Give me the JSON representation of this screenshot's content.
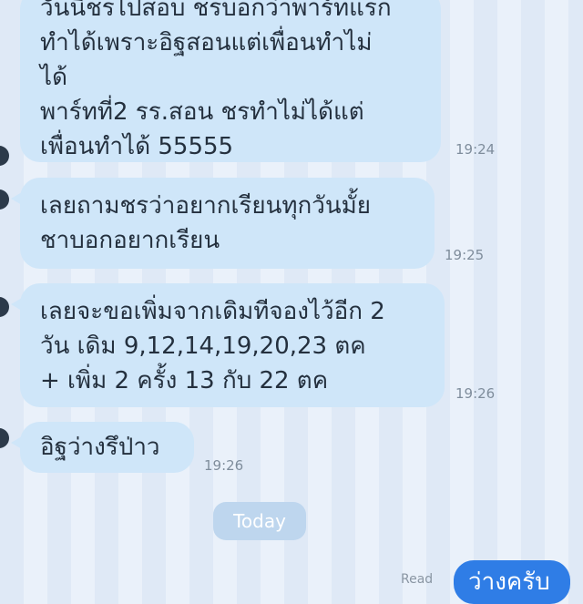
{
  "messages": [
    {
      "lines": [
        "วันนี้ชรไปสอบ ชรบอกว่าพาร์ทแรก",
        "ทำได้เพราะอิฐสอนแต่เพื่อนทำไม่",
        "ได้",
        "พาร์ทที่2 รร.สอน ชรทำไม่ได้แต่",
        "เพื่อนทำได้ 55555"
      ],
      "time": "19:24"
    },
    {
      "lines": [
        "เลยถามชรว่าอยากเรียนทุกวันมั้ย",
        "ชาบอกอยากเรียน"
      ],
      "time": "19:25"
    },
    {
      "lines": [
        "เลยจะขอเพิ่มจากเดิมทีจองไว้อีก 2",
        "วัน เดิม 9,12,14,19,20,23 ตค",
        "+ เพิ่ม 2 ครั้ง 13 กับ 22 ตค"
      ],
      "time": "19:26"
    },
    {
      "lines": [
        "อิฐว่างรึป่าว"
      ],
      "time": "19:26"
    }
  ],
  "date_divider": "Today",
  "outgoing": {
    "status": "Read",
    "text": "ว่างครับ"
  },
  "colors": {
    "incoming_bubble": "#cfe6f9",
    "outgoing_bubble": "#2f7de6",
    "date_pill": "#bed6ee"
  }
}
